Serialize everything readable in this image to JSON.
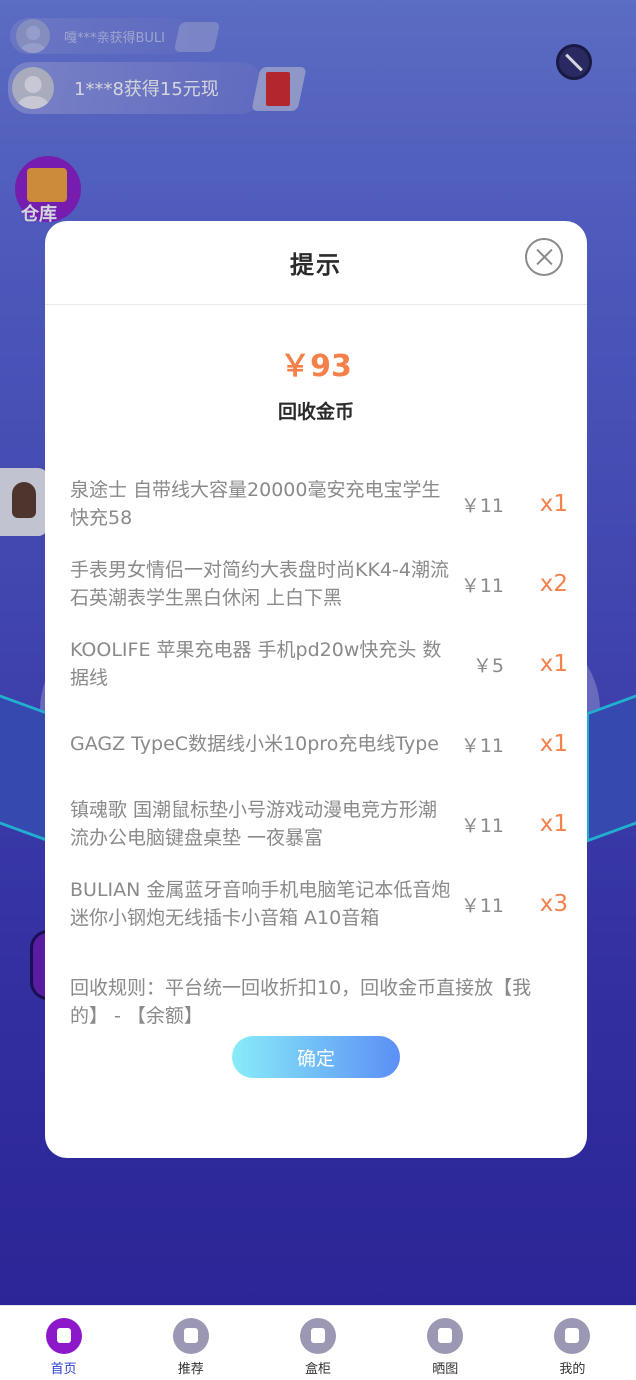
{
  "ticker": {
    "small_text": "嘎***亲获得BULI",
    "big_text": "1***8获得15元现"
  },
  "side": {
    "warehouse_label": "仓库"
  },
  "modal": {
    "title": "提示",
    "total_amount": "￥93",
    "total_label": "回收金币",
    "items": [
      {
        "name": "泉途士 自带线大容量20000毫安充电宝学生快充58",
        "price": "￥11",
        "qty": "x1"
      },
      {
        "name": "手表男女情侣一对简约大表盘时尚KK4-4潮流石英潮表学生黑白休闲 上白下黑",
        "price": "￥11",
        "qty": "x2"
      },
      {
        "name": "KOOLIFE 苹果充电器 手机pd20w快充头 数据线",
        "price": "￥5",
        "qty": "x1"
      },
      {
        "name": "GAGZ TypeC数据线小米10pro充电线Type",
        "price": "￥11",
        "qty": "x1"
      },
      {
        "name": "镇魂歌 国潮鼠标垫小号游戏动漫电竞方形潮流办公电脑键盘桌垫 一夜暴富",
        "price": "￥11",
        "qty": "x1"
      },
      {
        "name": "BULIAN 金属蓝牙音响手机电脑笔记本低音炮迷你小钢炮无线插卡小音箱 A10音箱",
        "price": "￥11",
        "qty": "x3"
      }
    ],
    "rule": "回收规则：平台统一回收折扣10，回收金币直接放【我的】 - 【余额】",
    "confirm_label": "确定"
  },
  "nav": {
    "items": [
      {
        "label": "首页",
        "icon": "home-cube-icon",
        "active": true
      },
      {
        "label": "推荐",
        "icon": "thumbs-up-icon",
        "active": false
      },
      {
        "label": "盒柜",
        "icon": "box-icon",
        "active": false
      },
      {
        "label": "晒图",
        "icon": "camera-icon",
        "active": false
      },
      {
        "label": "我的",
        "icon": "user-icon",
        "active": false
      }
    ]
  },
  "colors": {
    "accent_orange": "#f4804a",
    "active_purple": "#8d18c9",
    "button_gradient_start": "#88ecf8",
    "button_gradient_end": "#5b8ff6"
  }
}
